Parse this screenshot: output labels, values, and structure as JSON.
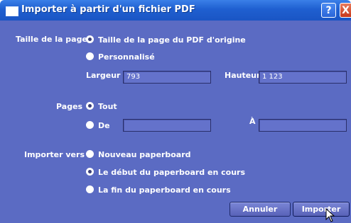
{
  "window": {
    "title": "Importer à partir d'un fichier PDF",
    "help_glyph": "?",
    "close_glyph": "X"
  },
  "page_size": {
    "label": "Taille de la page",
    "option_original": "Taille de la page du PDF d'origine",
    "option_custom": "Personnalisé",
    "selected": "original",
    "width_label": "Largeur",
    "width_value": "793",
    "height_label": "Hauteur",
    "height_value": "1 123"
  },
  "pages": {
    "label": "Pages",
    "option_all": "Tout",
    "option_from": "De",
    "selected": "all",
    "to_label": "À",
    "from_value": "",
    "to_value": ""
  },
  "import_to": {
    "label": "Importer vers",
    "option_new": "Nouveau paperboard",
    "option_start": "Le début du paperboard en cours",
    "option_end": "La fin du paperboard en cours",
    "selected": "start"
  },
  "buttons": {
    "cancel": "Annuler",
    "import": "Importer"
  },
  "colors": {
    "dialog_bg": "#5b6bc3",
    "titlebar": "#1f5fd0"
  }
}
